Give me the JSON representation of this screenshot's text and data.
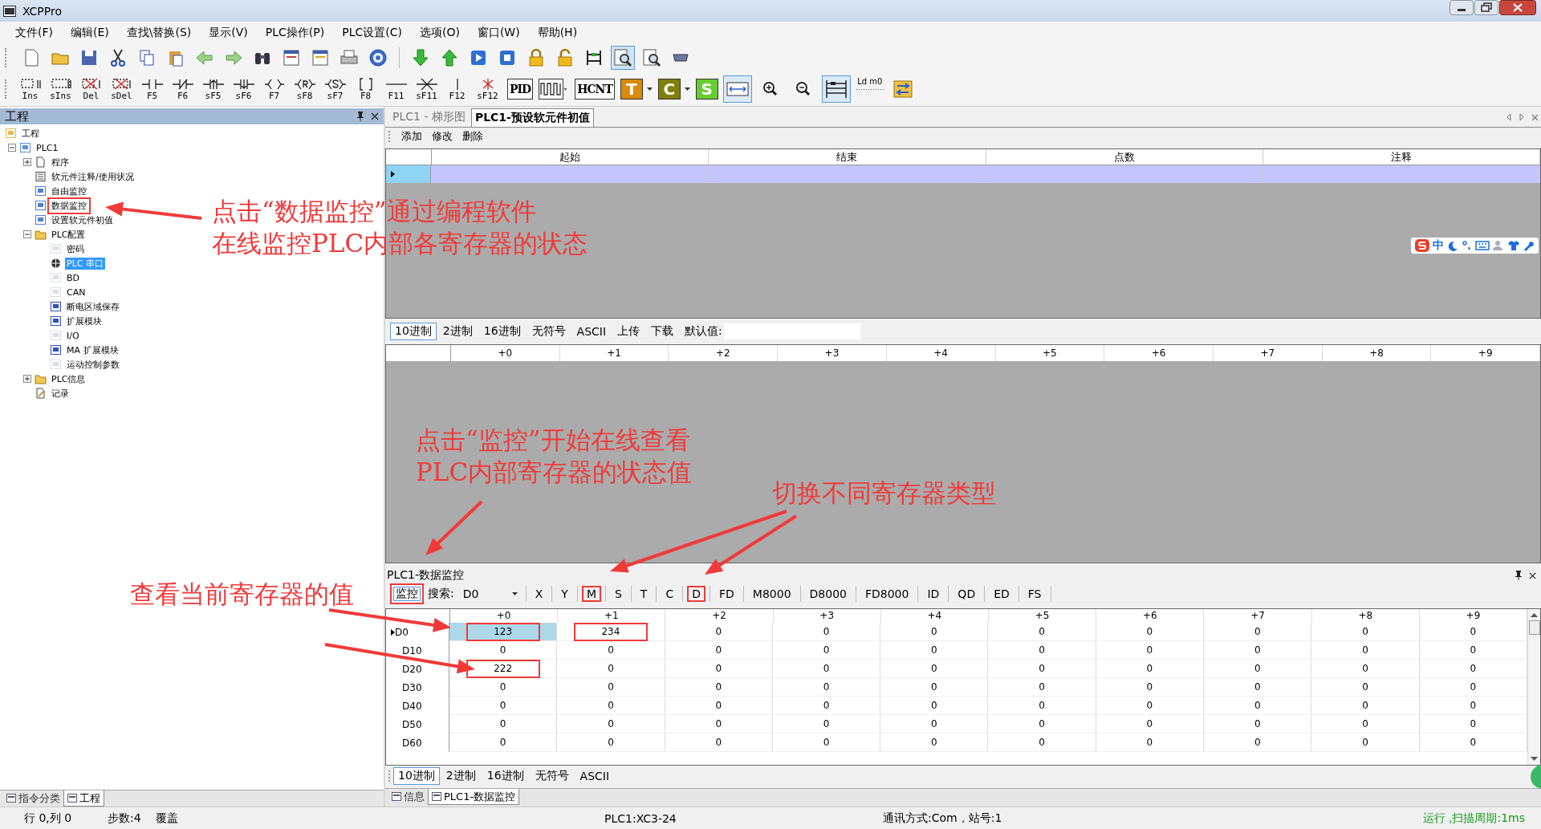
{
  "window": {
    "title": "XCPPro"
  },
  "menu": [
    "文件(F)",
    "编辑(E)",
    "查找\\替换(S)",
    "显示(V)",
    "PLC操作(P)",
    "PLC设置(C)",
    "选项(O)",
    "窗口(W)",
    "帮助(H)"
  ],
  "ladder_toolbar": [
    {
      "kind": "insert",
      "label": "Ins"
    },
    {
      "kind": "insert-wide",
      "label": "sIns"
    },
    {
      "kind": "delete",
      "label": "Del"
    },
    {
      "kind": "delete-wide",
      "label": "sDel"
    },
    {
      "kind": "contact",
      "label": "F5"
    },
    {
      "kind": "contact-nc",
      "label": "F6"
    },
    {
      "kind": "contact-rise",
      "label": "sF5"
    },
    {
      "kind": "contact-fall",
      "label": "sF6"
    },
    {
      "kind": "coil",
      "label": "F7"
    },
    {
      "kind": "coil-reset",
      "label": "sF8"
    },
    {
      "kind": "coil-set",
      "label": "sF7"
    },
    {
      "kind": "instruction",
      "label": "F8"
    },
    {
      "kind": "hline",
      "label": "F11"
    },
    {
      "kind": "hline-delete",
      "label": "sF11"
    },
    {
      "kind": "vline",
      "label": "F12"
    },
    {
      "kind": "vline-delete",
      "label": "sF12"
    }
  ],
  "function_buttons": [
    {
      "kind": "text",
      "label": "PID"
    },
    {
      "kind": "pulse"
    },
    {
      "kind": "text",
      "label": "HCNT"
    },
    {
      "kind": "colored",
      "label": "T",
      "color": "#d98a0a",
      "dropdown": true
    },
    {
      "kind": "colored",
      "label": "C",
      "color": "#808000",
      "dropdown": true
    },
    {
      "kind": "colored",
      "label": "S",
      "color": "#66cc33",
      "dropdown": false
    }
  ],
  "view_buttons": [
    {
      "kind": "fit",
      "selected": true
    },
    {
      "kind": "zoom-in",
      "selected": false
    },
    {
      "kind": "zoom-out",
      "selected": false
    },
    {
      "kind": "ladder",
      "selected": true
    },
    {
      "kind": "label",
      "label": "Ld m0",
      "selected": false
    },
    {
      "kind": "swap",
      "selected": false
    }
  ],
  "project_panel": {
    "title": "工程",
    "tree": [
      {
        "label": "工程",
        "kind": "project",
        "selected": false,
        "children": [
          {
            "label": "PLC1",
            "kind": "plc",
            "expanded": true,
            "selected": false,
            "children": [
              {
                "label": "程序",
                "kind": "document",
                "expanded": false,
                "selected": false
              },
              {
                "label": "软元件注释/使用状况",
                "kind": "list",
                "selected": false
              },
              {
                "label": "自由监控",
                "kind": "monitor",
                "selected": false
              },
              {
                "label": "数据监控",
                "kind": "monitor",
                "selected": false,
                "annotated": true
              },
              {
                "label": "设置软元件初值",
                "kind": "table",
                "selected": false
              },
              {
                "label": "PLC配置",
                "kind": "folder",
                "expanded": true,
                "selected": false,
                "children": [
                  {
                    "label": "密码",
                    "kind": "chip",
                    "selected": false
                  },
                  {
                    "label": "PLC 串口",
                    "kind": "globe",
                    "selected": true
                  },
                  {
                    "label": "BD",
                    "kind": "chip",
                    "selected": false
                  },
                  {
                    "label": "CAN",
                    "kind": "chip",
                    "selected": false
                  },
                  {
                    "label": "断电区域保存",
                    "kind": "chart",
                    "selected": false
                  },
                  {
                    "label": "扩展模块",
                    "kind": "module",
                    "selected": false
                  },
                  {
                    "label": "I/O",
                    "kind": "chip",
                    "selected": false
                  },
                  {
                    "label": "MA 扩展模块",
                    "kind": "module",
                    "selected": false
                  },
                  {
                    "label": "运动控制参数",
                    "kind": "chip",
                    "selected": false
                  }
                ]
              },
              {
                "label": "PLC信息",
                "kind": "folder",
                "expanded": false,
                "selected": false
              },
              {
                "label": "记录",
                "kind": "record",
                "selected": false
              }
            ]
          }
        ]
      }
    ]
  },
  "left_tabs": [
    {
      "label": "指令分类",
      "selected": false
    },
    {
      "label": "工程",
      "selected": true
    }
  ],
  "doc_tabs": [
    {
      "label": "PLC1 - 梯形图",
      "selected": false
    },
    {
      "label": "PLC1-预设软元件初值",
      "selected": true
    }
  ],
  "init_toolbar": [
    "添加",
    "修改",
    "删除"
  ],
  "init_table": {
    "columns": [
      "起始",
      "结束",
      "点数",
      "注释"
    ],
    "rows": [
      {
        "selected": true
      }
    ]
  },
  "ime": {
    "mode": "中"
  },
  "radix_bar": {
    "items": [
      {
        "label": "10进制",
        "selected": true
      },
      {
        "label": "2进制",
        "selected": false
      },
      {
        "label": "16进制",
        "selected": false
      },
      {
        "label": "无符号",
        "selected": false
      },
      {
        "label": "ASCII",
        "selected": false
      },
      {
        "label": "上传",
        "selected": false
      },
      {
        "label": "下载",
        "selected": false
      }
    ],
    "default_label": "默认值:"
  },
  "offset_columns": [
    "+0",
    "+1",
    "+2",
    "+3",
    "+4",
    "+5",
    "+6",
    "+7",
    "+8",
    "+9"
  ],
  "monitor_panel": {
    "title": "PLC1-数据监控",
    "monitor_button": {
      "label": "监控",
      "annotated": true
    },
    "search_label": "搜索:",
    "search_value": "D0",
    "types": [
      {
        "label": "X",
        "annotated": false
      },
      {
        "label": "Y",
        "annotated": false
      },
      {
        "label": "M",
        "annotated": true
      },
      {
        "label": "S",
        "annotated": false
      },
      {
        "label": "T",
        "annotated": false
      },
      {
        "label": "C",
        "annotated": false
      },
      {
        "label": "D",
        "annotated": true
      },
      {
        "label": "FD",
        "annotated": false
      },
      {
        "label": "M8000",
        "annotated": false
      },
      {
        "label": "D8000",
        "annotated": false
      },
      {
        "label": "FD8000",
        "annotated": false
      },
      {
        "label": "ID",
        "annotated": false
      },
      {
        "label": "QD",
        "annotated": false
      },
      {
        "label": "ED",
        "annotated": false
      },
      {
        "label": "FS",
        "annotated": false
      }
    ],
    "columns": [
      "+0",
      "+1",
      "+2",
      "+3",
      "+4",
      "+5",
      "+6",
      "+7",
      "+8",
      "+9"
    ],
    "rows": [
      {
        "label": "D0",
        "selected": true,
        "values": [
          "123",
          "234",
          "0",
          "0",
          "0",
          "0",
          "0",
          "0",
          "0",
          "0"
        ],
        "annotated": [
          true,
          true,
          false,
          false,
          false,
          false,
          false,
          false,
          false,
          false
        ]
      },
      {
        "label": "D10",
        "selected": false,
        "values": [
          "0",
          "0",
          "0",
          "0",
          "0",
          "0",
          "0",
          "0",
          "0",
          "0"
        ]
      },
      {
        "label": "D20",
        "selected": false,
        "values": [
          "222",
          "0",
          "0",
          "0",
          "0",
          "0",
          "0",
          "0",
          "0",
          "0"
        ],
        "annotated": [
          true,
          false,
          false,
          false,
          false,
          false,
          false,
          false,
          false,
          false
        ]
      },
      {
        "label": "D30",
        "selected": false,
        "values": [
          "0",
          "0",
          "0",
          "0",
          "0",
          "0",
          "0",
          "0",
          "0",
          "0"
        ]
      },
      {
        "label": "D40",
        "selected": false,
        "values": [
          "0",
          "0",
          "0",
          "0",
          "0",
          "0",
          "0",
          "0",
          "0",
          "0"
        ]
      },
      {
        "label": "D50",
        "selected": false,
        "values": [
          "0",
          "0",
          "0",
          "0",
          "0",
          "0",
          "0",
          "0",
          "0",
          "0"
        ]
      },
      {
        "label": "D60",
        "selected": false,
        "values": [
          "0",
          "0",
          "0",
          "0",
          "0",
          "0",
          "0",
          "0",
          "0",
          "0"
        ]
      }
    ],
    "radix": [
      {
        "label": "10进制",
        "selected": true
      },
      {
        "label": "2进制",
        "selected": false
      },
      {
        "label": "16进制",
        "selected": false
      },
      {
        "label": "无符号",
        "selected": false
      },
      {
        "label": "ASCII",
        "selected": false
      }
    ]
  },
  "bottom_tabs": [
    {
      "label": "信息",
      "selected": false
    },
    {
      "label": "PLC1-数据监控",
      "selected": true
    }
  ],
  "status_bar": {
    "position": "行 0,列 0",
    "steps": "步数:4",
    "mode": "覆盖",
    "model": "PLC1:XC3-24",
    "comm": "通讯方式:Com，站号:1",
    "run": "运行 ,扫描周期:1ms"
  },
  "annotations": [
    {
      "kind": "tree",
      "lines": [
        "点击“数据监控”通过编程软件",
        "在线监控PLC内部各寄存器的状态"
      ]
    },
    {
      "kind": "monitor",
      "lines": [
        "点击“监控”开始在线查看",
        "PLC内部寄存器的状态值"
      ]
    },
    {
      "kind": "types",
      "lines": [
        "切换不同寄存器类型"
      ]
    },
    {
      "kind": "values",
      "lines": [
        "查看当前寄存器的值"
      ]
    }
  ]
}
